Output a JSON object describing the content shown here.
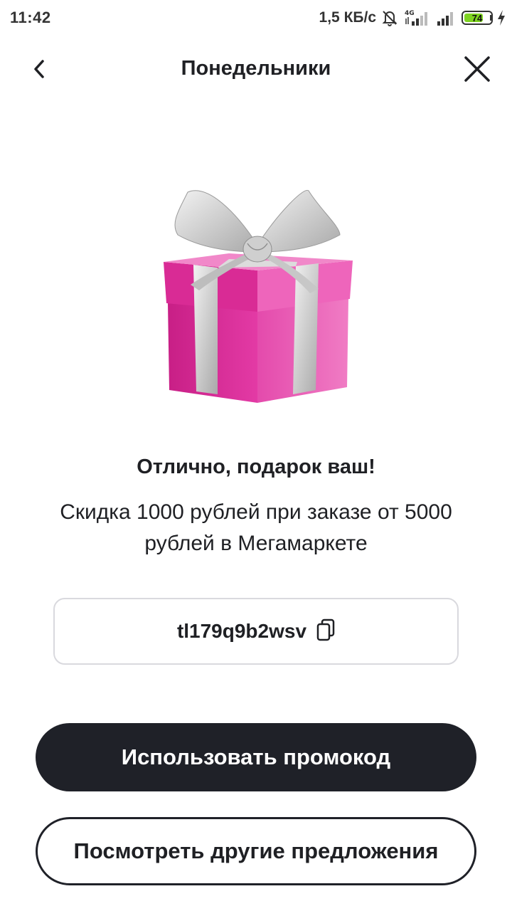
{
  "status_bar": {
    "time": "11:42",
    "net_speed": "1,5 КБ/с",
    "network_type": "4G",
    "battery_level": "74",
    "battery_fraction": 0.74,
    "icons": [
      "mute-bell-icon",
      "signal-4g-icon",
      "signal-icon",
      "battery-icon",
      "charging-icon"
    ]
  },
  "header": {
    "title": "Понедельники",
    "back_icon": "chevron-left-icon",
    "close_icon": "close-icon"
  },
  "content": {
    "image": "gift-box",
    "headline": "Отлично, подарок ваш!",
    "description": "Скидка 1000 рублей при заказе от 5000 рублей в Мегамаркете",
    "promo_code": "tl179q9b2wsv",
    "copy_icon": "copy-icon"
  },
  "actions": {
    "primary_label": "Использовать промокод",
    "secondary_label": "Посмотреть другие предложения"
  },
  "colors": {
    "primary_button": "#1f2128",
    "gift_box": "#e0309e",
    "ribbon": "#d4d4d4",
    "battery": "#7ed321"
  }
}
